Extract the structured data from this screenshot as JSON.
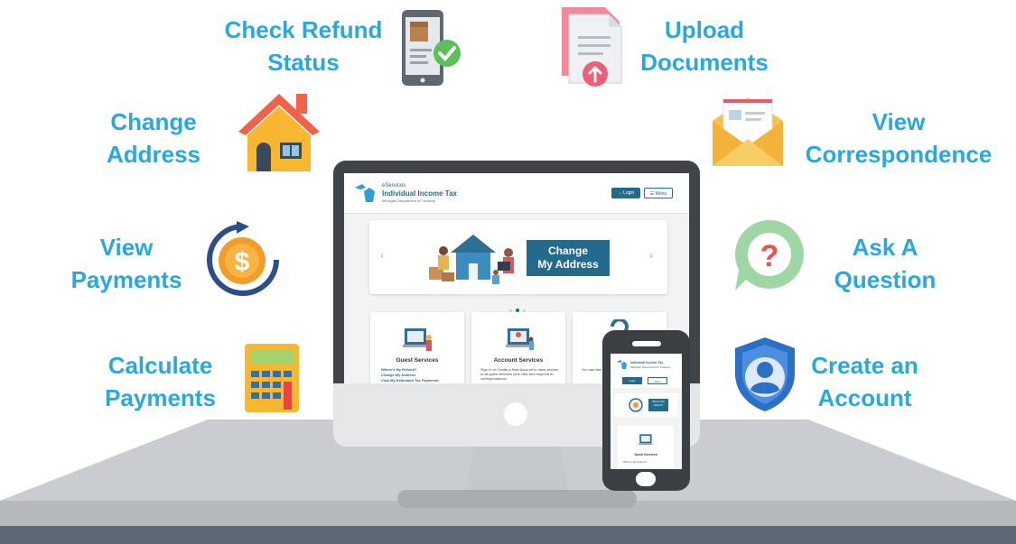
{
  "features": {
    "check_refund": {
      "line1": "Check Refund",
      "line2": "Status"
    },
    "upload_documents": {
      "line1": "Upload",
      "line2": "Documents"
    },
    "change_address": {
      "line1": "Change",
      "line2": "Address"
    },
    "view_correspondence": {
      "line1": "View",
      "line2": "Correspondence"
    },
    "view_payments": {
      "line1": "View",
      "line2": "Payments"
    },
    "ask_question": {
      "line1": "Ask A",
      "line2": "Question"
    },
    "calculate_payments": {
      "line1": "Calculate",
      "line2": "Payments"
    },
    "create_account": {
      "line1": "Create an",
      "line2": "Account"
    }
  },
  "site": {
    "subtitle": "eServices",
    "title": "Individual Income Tax",
    "department": "Michigan Department of Treasury",
    "login_label": "→ Login",
    "menu_label": "☰ Menu",
    "banner": {
      "line1": "Change",
      "line2": "My Address"
    },
    "prev_arrow": "‹",
    "next_arrow": "›",
    "cards": {
      "guest": {
        "title": "Guest Services",
        "links": [
          "Where's My Refund?",
          "Change My Address",
          "View My Estimated Tax Payments"
        ]
      },
      "account": {
        "title": "Account Services",
        "text": "Sign In or Create a New Account to have access to all guest services plus view and respond to correspondence."
      },
      "third": {
        "text": "You can ask a request co..."
      }
    }
  },
  "phone_site": {
    "title": "Individual Income Tax",
    "department": "Michigan Department of Treasury",
    "login_label": "Login",
    "menu_label": "Menu",
    "banner": "Where's My Refund?",
    "card_title": "Guest Services",
    "card_link": "Where's My Refund?"
  },
  "colors": {
    "accent": "#29a8e0",
    "site_blue": "#246a8c",
    "desk": "#c9ccd0",
    "desk_front": "#5c6873",
    "monitor_frame": "#3f4449"
  }
}
